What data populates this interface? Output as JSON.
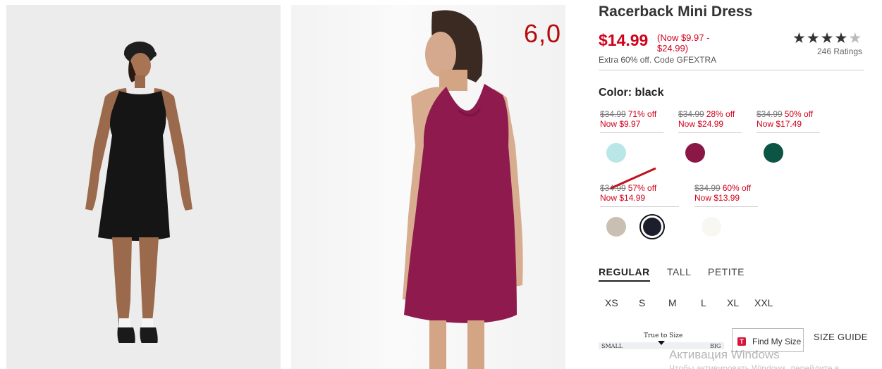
{
  "product": {
    "title": "Racerback Mini Dress",
    "price": "$14.99",
    "price_range": "(Now $9.97 - $24.99)",
    "promo": "Extra 60% off. Code GFEXTRA",
    "rating_stars": "★★★★",
    "rating_half_star": "★",
    "rating_value": 4.5,
    "ratings_count": "246 Ratings"
  },
  "gallery": {
    "overlay_number": "6,0",
    "images": [
      {
        "alt": "black racerback dress front view"
      },
      {
        "alt": "magenta racerback dress back view"
      }
    ]
  },
  "color": {
    "label": "Color: black",
    "options": [
      {
        "orig": "$34.99",
        "off": "71% off",
        "now": "Now $9.97",
        "color": "#b9e6e6",
        "selected": false
      },
      {
        "orig": "$34.99",
        "off": "28% off",
        "now": "Now $24.99",
        "color": "#8b1747",
        "selected": false
      },
      {
        "orig": "$34.99",
        "off": "50% off",
        "now": "Now $17.49",
        "color": "#0c5443",
        "selected": false
      },
      {
        "orig": "$34.99",
        "off": "57% off",
        "now": "Now $14.99",
        "color": "#c9bfb2",
        "selected": false
      },
      {
        "orig": "",
        "off": "",
        "now": "",
        "color": "#1c1f2b",
        "selected": true
      },
      {
        "orig": "$34.99",
        "off": "60% off",
        "now": "Now $13.99",
        "color": "#f8f7f2",
        "selected": false
      }
    ]
  },
  "fit": {
    "tabs": [
      "REGULAR",
      "TALL",
      "PETITE"
    ],
    "active": "REGULAR"
  },
  "sizes": [
    "XS",
    "S",
    "M",
    "L",
    "XL",
    "XXL"
  ],
  "fit_meter": {
    "true_to_size": "True to Size",
    "small": "SMALL",
    "big": "BIG"
  },
  "find_my_size": {
    "icon_letter": "T",
    "label": "Find My Size"
  },
  "size_guide": "SIZE GUIDE",
  "watermark": {
    "line1": "Активация Windows",
    "line2": "Чтобы активировать Windows, перейдите в"
  }
}
